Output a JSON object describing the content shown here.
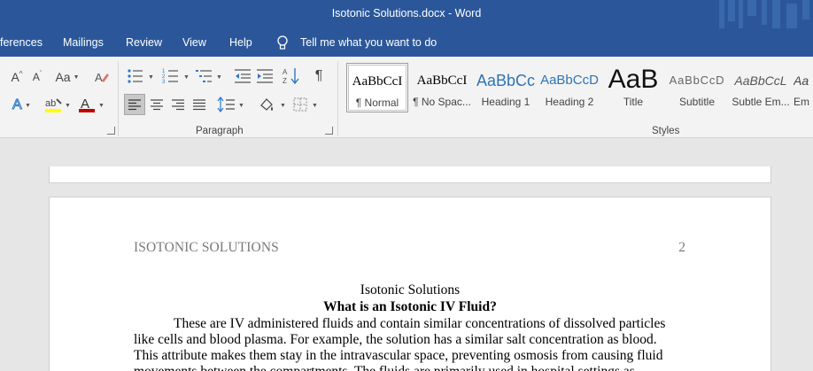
{
  "window": {
    "title": "Isotonic Solutions.docx  -  Word"
  },
  "tabs": [
    {
      "label": "ferences"
    },
    {
      "label": "Mailings"
    },
    {
      "label": "Review"
    },
    {
      "label": "View"
    },
    {
      "label": "Help"
    },
    {
      "label": "Tell me what you want to do"
    }
  ],
  "ribbon": {
    "font_grow": "A",
    "font_shrink": "A",
    "change_case": "Aa",
    "paragraph_mark": "¶",
    "paragraph_label": "Paragraph",
    "styles_label": "Styles",
    "styles": [
      {
        "preview": "AaBbCcI",
        "name": "¶ Normal"
      },
      {
        "preview": "AaBbCcI",
        "name": "¶ No Spac..."
      },
      {
        "preview": "AaBbCc",
        "name": "Heading 1"
      },
      {
        "preview": "AaBbCcD",
        "name": "Heading 2"
      },
      {
        "preview": "AaB",
        "name": "Title"
      },
      {
        "preview": "AaBbCcD",
        "name": "Subtitle"
      },
      {
        "preview": "AaBbCcL",
        "name": "Subtle Em..."
      },
      {
        "preview": "Aa",
        "name": "Em"
      }
    ],
    "colors": {
      "highlight": "#ffff00",
      "font_color": "#c00000",
      "accent": "#2b579a"
    }
  },
  "document": {
    "running_head": "ISOTONIC SOLUTIONS",
    "page_number": "2",
    "title": "Isotonic Solutions",
    "heading": "What is an Isotonic IV Fluid?",
    "lines": [
      "These are IV administered fluids and contain similar concentrations of dissolved particles",
      "like cells and blood plasma. For example, the solution has a similar salt concentration as blood.",
      "This attribute makes them stay in the intravascular space, preventing osmosis from causing fluid",
      "movements between the compartments. The fluids are primarily used in hospital settings as"
    ]
  }
}
